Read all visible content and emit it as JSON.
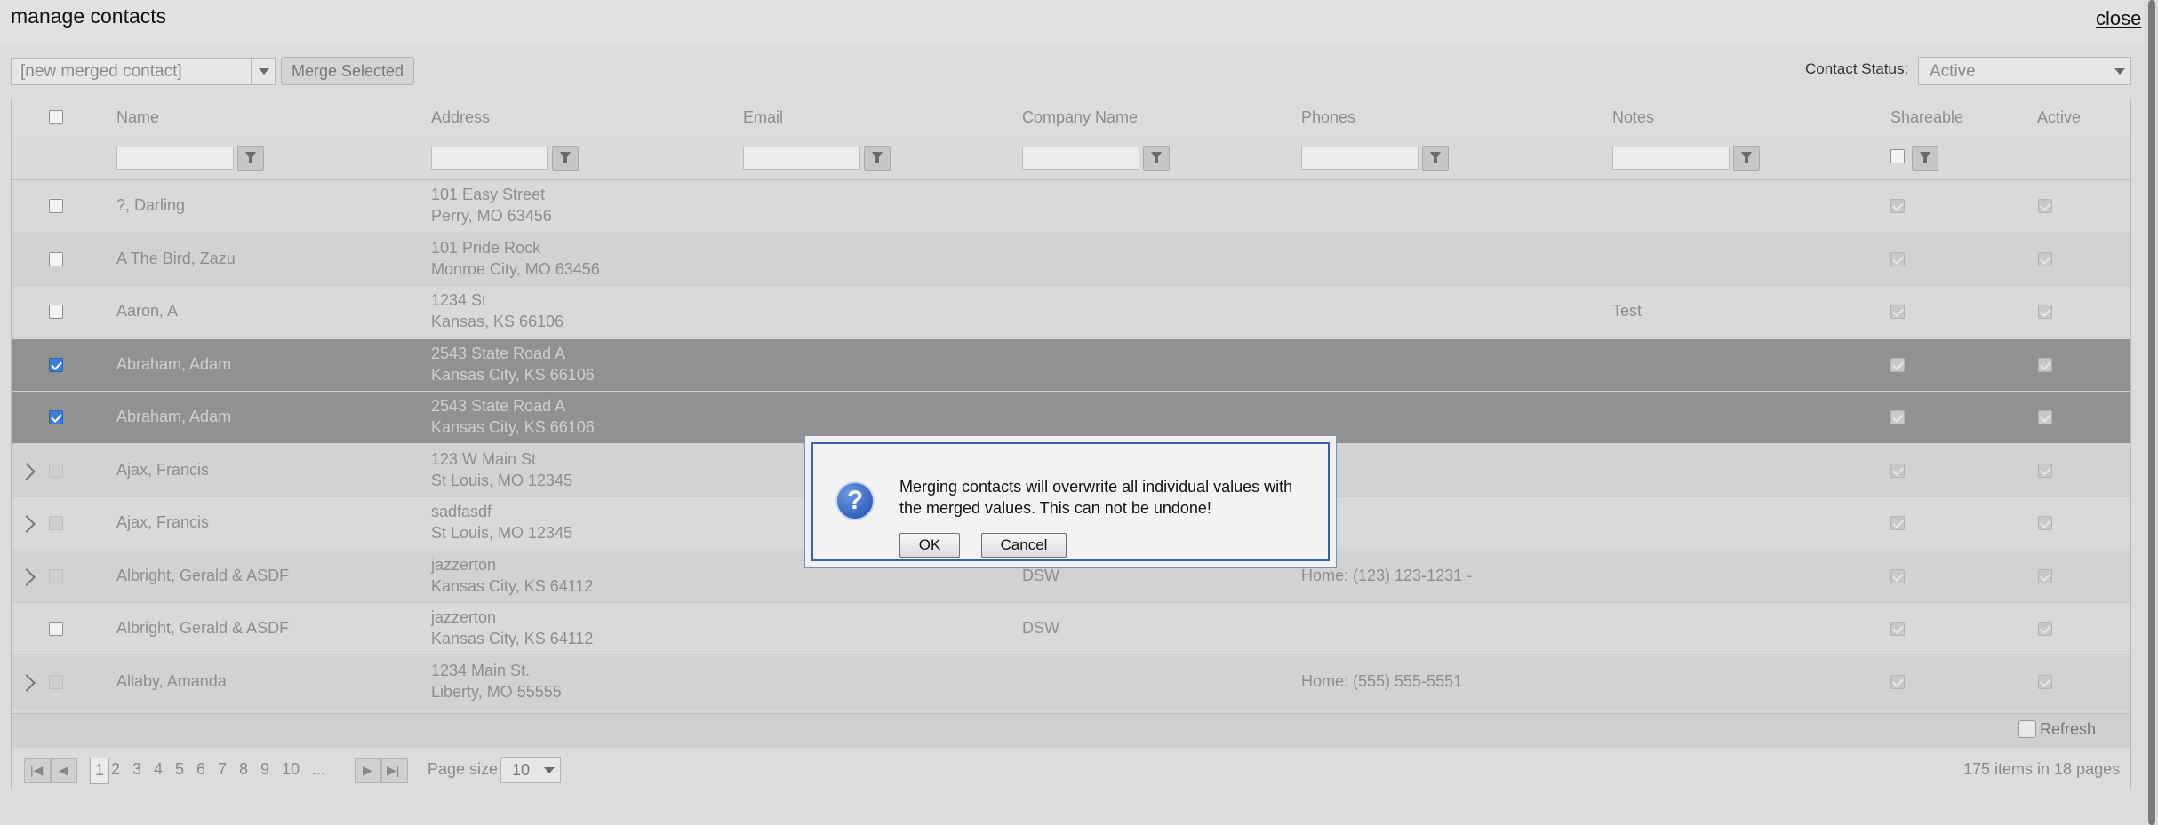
{
  "page": {
    "title": "manage contacts",
    "close": "close"
  },
  "toolbar": {
    "merge_target": "[new merged contact]",
    "merge_button": "Merge Selected",
    "status_label": "Contact Status:",
    "status_value": "Active"
  },
  "columns": [
    "Name",
    "Address",
    "Email",
    "Company Name",
    "Phones",
    "Notes",
    "Shareable",
    "Active"
  ],
  "rows": [
    {
      "name": "?, Darling",
      "addr1": "101 Easy Street",
      "addr2": "Perry, MO 63456",
      "company": "",
      "phones": "",
      "notes": "",
      "checked": false,
      "disabled": false,
      "expand": false
    },
    {
      "name": "A The Bird, Zazu",
      "addr1": "101 Pride Rock",
      "addr2": "Monroe City, MO 63456",
      "company": "",
      "phones": "",
      "notes": "",
      "checked": false,
      "disabled": false,
      "expand": false
    },
    {
      "name": "Aaron, A",
      "addr1": "1234 St",
      "addr2": "Kansas, KS 66106",
      "company": "",
      "phones": "",
      "notes": "Test",
      "checked": false,
      "disabled": false,
      "expand": false
    },
    {
      "name": "Abraham, Adam",
      "addr1": "2543 State Road A",
      "addr2": "Kansas City, KS 66106",
      "company": "",
      "phones": "",
      "notes": "",
      "checked": true,
      "disabled": false,
      "expand": false
    },
    {
      "name": "Abraham, Adam",
      "addr1": "2543 State Road A",
      "addr2": "Kansas City, KS 66106",
      "company": "",
      "phones": "",
      "notes": "",
      "checked": true,
      "disabled": false,
      "expand": false
    },
    {
      "name": "Ajax, Francis",
      "addr1": "123 W Main St",
      "addr2": "St Louis, MO 12345",
      "company": "",
      "phones": "",
      "notes": "",
      "checked": false,
      "disabled": true,
      "expand": true
    },
    {
      "name": "Ajax, Francis",
      "addr1": "sadfasdf",
      "addr2": "St Louis, MO 12345",
      "company": "",
      "phones": "",
      "notes": "",
      "checked": false,
      "disabled": true,
      "expand": true
    },
    {
      "name": "Albright, Gerald & ASDF",
      "addr1": "jazzerton",
      "addr2": "Kansas City, KS 64112",
      "company": "DSW",
      "phones": "Home: (123) 123-1231 -",
      "notes": "",
      "checked": false,
      "disabled": true,
      "expand": true
    },
    {
      "name": "Albright, Gerald & ASDF",
      "addr1": "jazzerton",
      "addr2": "Kansas City, KS 64112",
      "company": "DSW",
      "phones": "",
      "notes": "",
      "checked": false,
      "disabled": false,
      "expand": false
    },
    {
      "name": "Allaby, Amanda",
      "addr1": "1234 Main St.",
      "addr2": "Liberty, MO 55555",
      "company": "",
      "phones": "Home: (555) 555-5551",
      "notes": "",
      "checked": false,
      "disabled": true,
      "expand": true
    }
  ],
  "footer": {
    "refresh": "Refresh",
    "pages": [
      "1",
      "2",
      "3",
      "4",
      "5",
      "6",
      "7",
      "8",
      "9",
      "10",
      "..."
    ],
    "current_page": "1",
    "page_size_label": "Page size:",
    "page_size": "10",
    "items_info": "175 items in 18 pages"
  },
  "dialog": {
    "message": "Merging contacts will overwrite all individual values with the merged values. This can not be undone!",
    "ok": "OK",
    "cancel": "Cancel",
    "icon": "question-icon"
  }
}
